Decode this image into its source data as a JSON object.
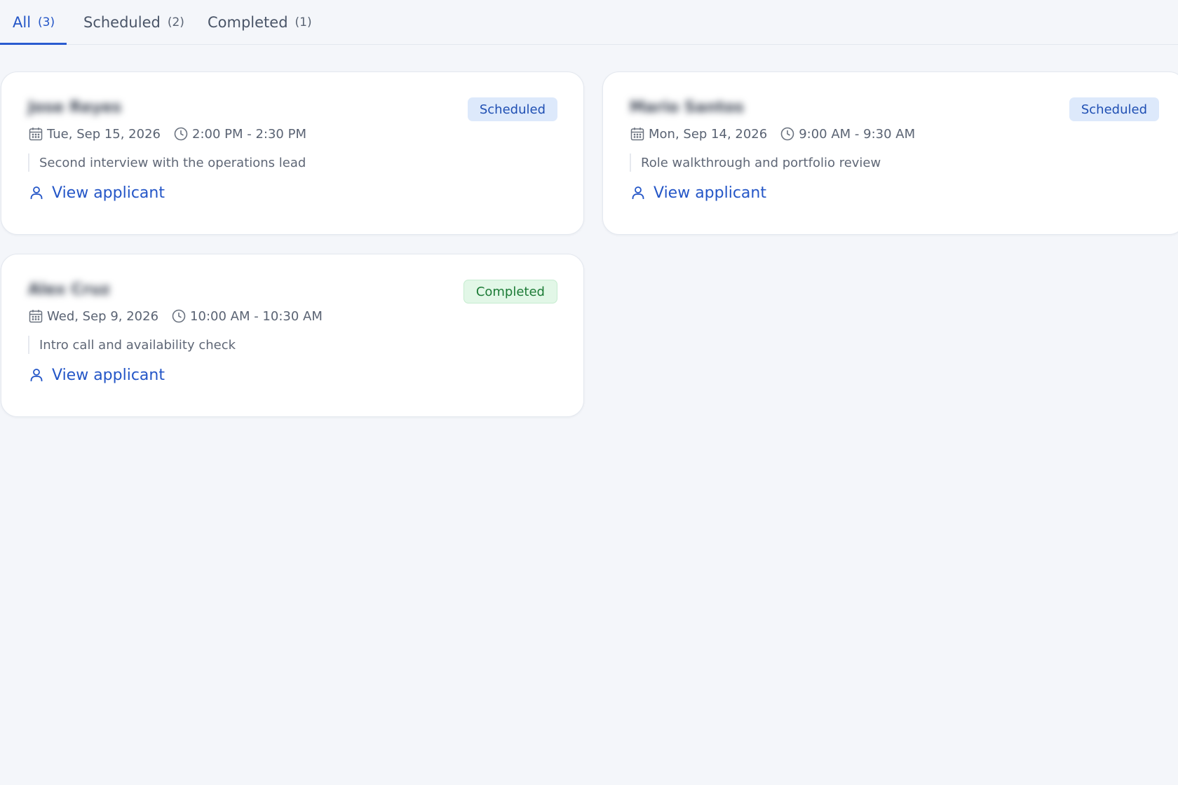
{
  "tabs": [
    {
      "label": "All",
      "count": "(3)"
    },
    {
      "label": "Scheduled",
      "count": "(2)"
    },
    {
      "label": "Completed",
      "count": "(1)"
    }
  ],
  "active_tab": "All",
  "cards": [
    {
      "name": "Jose Reyes",
      "status": "Scheduled",
      "date": "Tue, Sep 15, 2026",
      "time": "2:00 PM - 2:30 PM",
      "note": "Second interview with the operations lead",
      "link": "View applicant"
    },
    {
      "name": "Mario Santos",
      "status": "Scheduled",
      "date": "Mon, Sep 14, 2026",
      "time": "9:00 AM - 9:30 AM",
      "note": "Role walkthrough and portfolio review",
      "link": "View applicant"
    },
    {
      "name": "Alex Cruz",
      "status": "Completed",
      "date": "Wed, Sep 9, 2026",
      "time": "10:00 AM - 10:30 AM",
      "note": "Intro call and availability check",
      "link": "View applicant"
    }
  ],
  "colors": {
    "accent": "#2456c7",
    "scheduled_bg": "#dde9fb",
    "completed_bg": "#e2f7e7",
    "completed_text": "#1c7b36"
  },
  "icons": {
    "date": "calendar-icon",
    "time": "clock-icon",
    "link": "user-icon"
  }
}
